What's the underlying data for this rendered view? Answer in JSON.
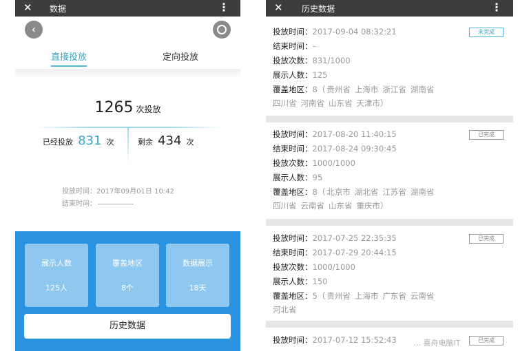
{
  "left": {
    "appbar_title": "数据",
    "back_glyph": "✕",
    "more_glyph": "⋮",
    "tabs": [
      "直接投放",
      "定向投放"
    ],
    "total_number": "1265",
    "total_unit": "次投放",
    "delivered_label": "已经投放",
    "delivered_value": "831",
    "delivered_unit": "次",
    "remaining_label": "剩余",
    "remaining_value": "434",
    "remaining_unit": "次",
    "start_time": "投放时间：2017年09月01日 10:42",
    "end_time_label": "结束时间：",
    "cards": [
      {
        "title": "展示人数",
        "value": "125人"
      },
      {
        "title": "覆盖地区",
        "value": "8个"
      },
      {
        "title": "数据展示",
        "value": "18天"
      }
    ],
    "history_button": "历史数据",
    "colors": {
      "accent": "#3aa7c2",
      "panel": "#2a93e0"
    }
  },
  "right": {
    "appbar_title": "历史数据",
    "back_glyph": "✕",
    "more_glyph": "⋮",
    "labels": {
      "start": "投放时间：",
      "end": "结束时间：",
      "count": "投放次数：",
      "people": "展示人数：",
      "region": "覆盖地区："
    },
    "records": [
      {
        "status": "未完成",
        "start": "2017-09-04 08:32:21",
        "end": "–",
        "count": "831/1000",
        "people": "125",
        "region_count": "8（",
        "regions_line1": [
          "贵州省",
          "上海市",
          "浙江省",
          "湖南省"
        ],
        "regions_line2": [
          "四川省",
          "河南省",
          "山东省",
          "天津市）"
        ]
      },
      {
        "status": "已完成",
        "start": "2017-08-20 11:40:15",
        "end": "2017-08-24 09:30:45",
        "count": "1000/1000",
        "people": "95",
        "region_count": "8（",
        "regions_line1": [
          "北京市",
          "湖北省",
          "江苏省",
          "湖南省"
        ],
        "regions_line2": [
          "四川省",
          "云南省",
          "山东省",
          "重庆市）"
        ]
      },
      {
        "status": "已完成",
        "start": "2017-07-25 22:35:35",
        "end": "2017-07-29 20:44:15",
        "count": "1000/1000",
        "people": "150",
        "region_count": "5（",
        "regions_line1": [
          "贵州省",
          "上海市",
          "广东省",
          "云南省"
        ],
        "regions_line2": [
          "河北省"
        ]
      },
      {
        "status": "已完成",
        "start": "2017-07-12 15:52:43",
        "end": "",
        "count": "",
        "people": "",
        "region_count": "",
        "regions_line1": [],
        "regions_line2": []
      }
    ]
  },
  "watermark": "… 喜舟电脑IT"
}
